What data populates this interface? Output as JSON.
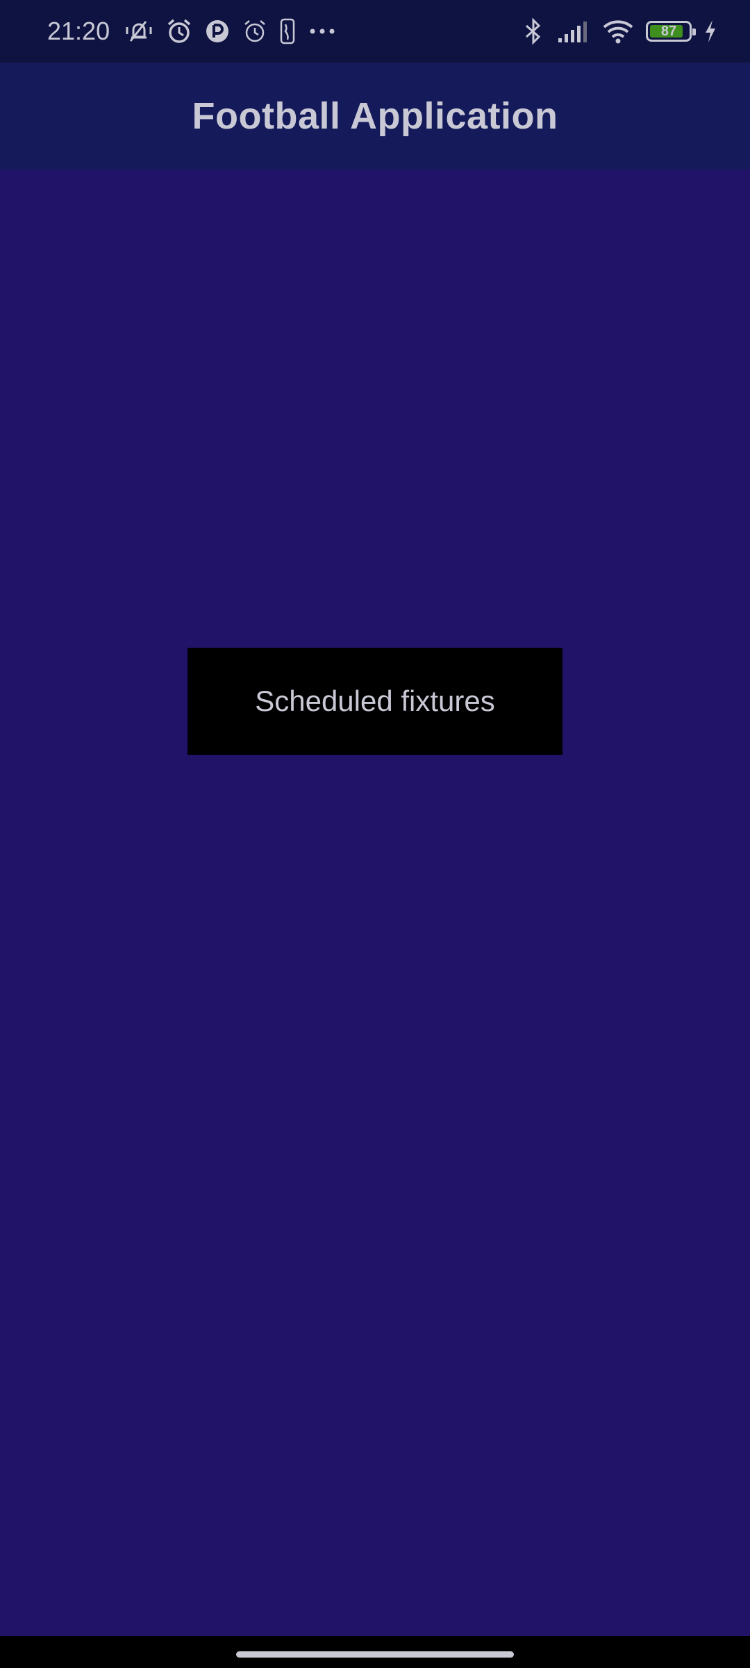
{
  "status_bar": {
    "time": "21:20",
    "left_icons": [
      "vibrate-mute-icon",
      "alarm-icon",
      "app-notification-icon",
      "alarm-outline-icon",
      "nba-icon",
      "more-dots-icon"
    ],
    "right_icons": [
      "bluetooth-icon",
      "signal-icon",
      "wifi-icon",
      "battery-icon",
      "charging-icon"
    ],
    "battery_level": "87",
    "battery_fraction": 0.87
  },
  "app_bar": {
    "title": "Football Application"
  },
  "main": {
    "fixtures_button_label": "Scheduled fixtures"
  },
  "colors": {
    "status_bar_bg": "#0e1341",
    "app_bar_bg": "#141a5a",
    "page_bg": "#211468",
    "button_bg": "#000000",
    "text": "#c9c9d6",
    "battery_fill": "#3f8f1f"
  }
}
